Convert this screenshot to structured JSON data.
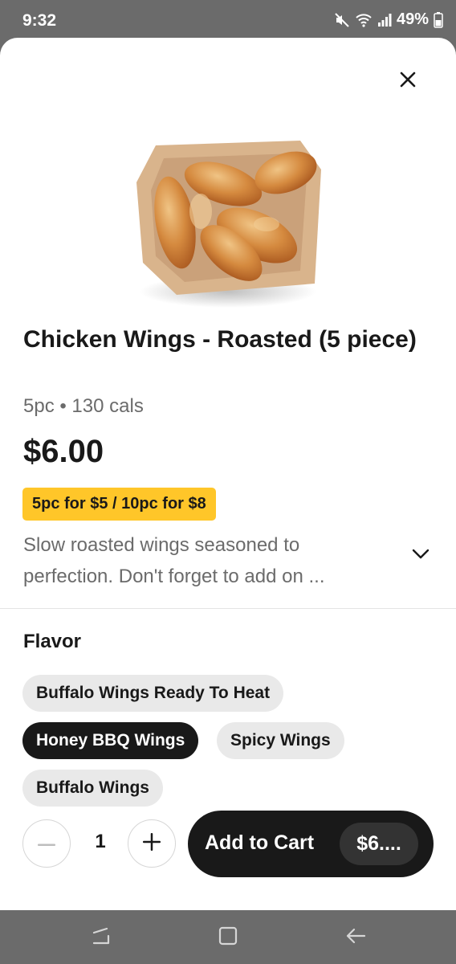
{
  "status_bar": {
    "time": "9:32",
    "battery": "49%",
    "icons": [
      "mute-icon",
      "wifi-icon",
      "signal-icon",
      "battery-icon"
    ]
  },
  "product": {
    "title": "Chicken Wings - Roasted (5 piece)",
    "meta": "5pc • 130 cals",
    "price": "$6.00",
    "promo": "5pc for $5 / 10pc for $8",
    "description": "Slow roasted wings seasoned to perfection. Don't forget to add on ..."
  },
  "flavor": {
    "title": "Flavor",
    "options": [
      {
        "label": "Buffalo Wings Ready To Heat",
        "selected": false
      },
      {
        "label": "Honey BBQ Wings",
        "selected": true
      },
      {
        "label": "Spicy Wings",
        "selected": false
      },
      {
        "label": "Buffalo Wings",
        "selected": false
      }
    ]
  },
  "cart": {
    "quantity": "1",
    "add_label": "Add to Cart",
    "price": "$6...."
  },
  "colors": {
    "promo": "#ffc629",
    "primary_dark": "#191919",
    "chip_bg": "#e9e9e9",
    "muted_text": "#6b6b6b"
  }
}
